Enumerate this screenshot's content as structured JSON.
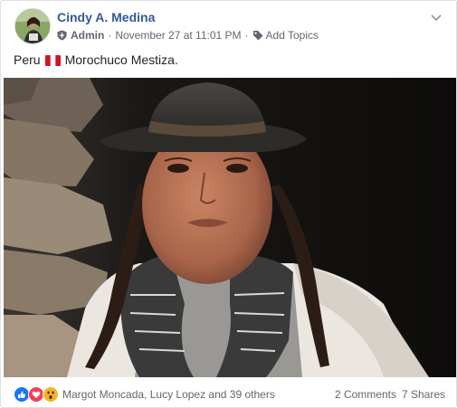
{
  "post": {
    "author": "Cindy A. Medina",
    "role": "Admin",
    "separator": "·",
    "timestamp": "November 27 at 11:01 PM",
    "add_topics": "Add Topics",
    "text_before_flag": "Peru",
    "flag_icon": "peru-flag",
    "text_after_flag": "Morochuco Mestiza.",
    "photo_icon": "photo-woman-in-hat"
  },
  "footer": {
    "reaction_icons": [
      "like-icon",
      "love-icon",
      "wow-icon"
    ],
    "reactors": "Margot Moncada, Lucy Lopez and 39 others",
    "comments": "2 Comments",
    "shares": "7 Shares"
  },
  "colors": {
    "link_blue": "#365899",
    "like_blue": "#1877f2",
    "love_red": "#f33e58",
    "wow_yellow": "#f7b125",
    "peru_red": "#d91023"
  }
}
